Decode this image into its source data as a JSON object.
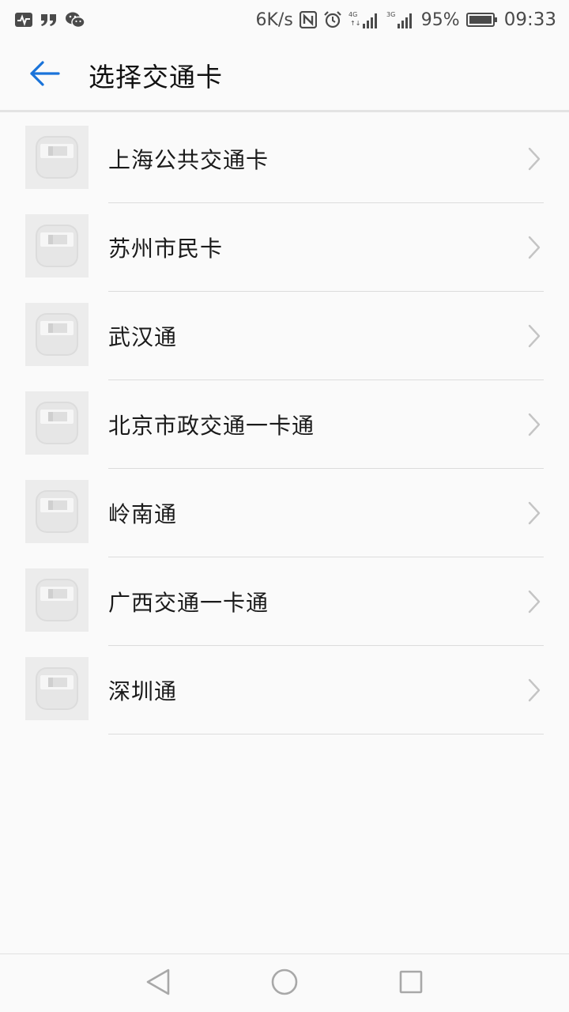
{
  "status_bar": {
    "net_speed": "6K/s",
    "battery": "95%",
    "time": "09:33",
    "network_4g": "4G",
    "network_3g": "3G",
    "icons": [
      "activity-icon",
      "quote-icon",
      "wechat-icon",
      "nfc-icon",
      "alarm-icon",
      "signal-4g-icon",
      "signal-3g-icon",
      "battery-icon"
    ]
  },
  "app_bar": {
    "title": "选择交通卡",
    "back_icon": "arrow-left-icon",
    "accent": "#1a73d9"
  },
  "cards": [
    {
      "label": "上海公共交通卡"
    },
    {
      "label": "苏州市民卡"
    },
    {
      "label": "武汉通"
    },
    {
      "label": "北京市政交通一卡通"
    },
    {
      "label": "岭南通"
    },
    {
      "label": "广西交通一卡通"
    },
    {
      "label": "深圳通"
    }
  ],
  "nav_bar": {
    "icons": [
      "back-triangle-icon",
      "home-circle-icon",
      "recents-square-icon"
    ]
  }
}
